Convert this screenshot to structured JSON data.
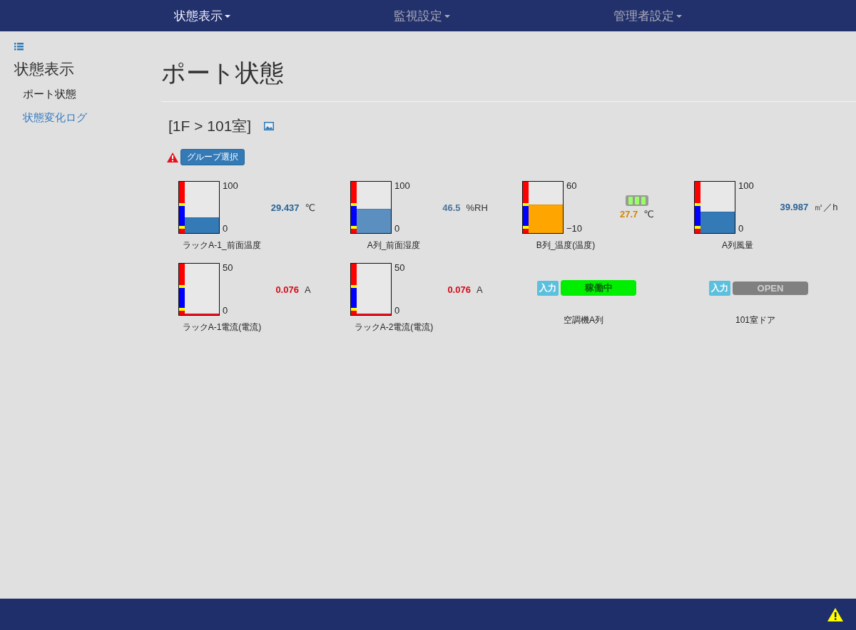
{
  "nav": [
    {
      "label": "状態表示",
      "selected": true
    },
    {
      "label": "監視設定",
      "selected": false
    },
    {
      "label": "管理者設定",
      "selected": false
    }
  ],
  "sidebar": {
    "title": "状態表示",
    "items": [
      {
        "label": "ポート状態",
        "selected": true
      },
      {
        "label": "状態変化ログ",
        "selected": false
      }
    ]
  },
  "page_title": "ポート状態",
  "location": "[1F > 101室]",
  "group_button": "グループ選択",
  "ports": [
    {
      "kind": "gauge",
      "name": "ラックA-1_前面温度",
      "max": "100",
      "min": "0",
      "value": "29.437",
      "unit": "℃",
      "level": 0.29,
      "color": "#337ab7"
    },
    {
      "kind": "gauge",
      "name": "A列_前面湿度",
      "max": "100",
      "min": "0",
      "value": "46.5",
      "unit": "%RH",
      "level": 0.46,
      "color": "#5a8fc0"
    },
    {
      "kind": "gauge",
      "name": "B列_温度(温度)",
      "max": "60",
      "min": "−10",
      "value": "27.7",
      "unit": "℃",
      "level": 0.54,
      "color": "#ffa500",
      "signal": true
    },
    {
      "kind": "gauge",
      "name": "A列風量",
      "max": "100",
      "min": "0",
      "value": "39.987",
      "unit": "㎥／h",
      "level": 0.4,
      "color": "#337ab7"
    },
    {
      "kind": "gauge",
      "name": "ラックA-1電流(電流)",
      "max": "50",
      "min": "0",
      "value": "0.076",
      "unit": "A",
      "level": 0.0,
      "color": "#ff1020"
    },
    {
      "kind": "gauge",
      "name": "ラックA-2電流(電流)",
      "max": "50",
      "min": "0",
      "value": "0.076",
      "unit": "A",
      "level": 0.0,
      "color": "#ff1020"
    },
    {
      "kind": "status",
      "name": "空調機A列",
      "tag": "入力",
      "state": "稼働中",
      "color": "#00ee00"
    },
    {
      "kind": "status",
      "name": "101室ドア",
      "tag": "入力",
      "state": "OPEN",
      "color": "#808080"
    }
  ]
}
